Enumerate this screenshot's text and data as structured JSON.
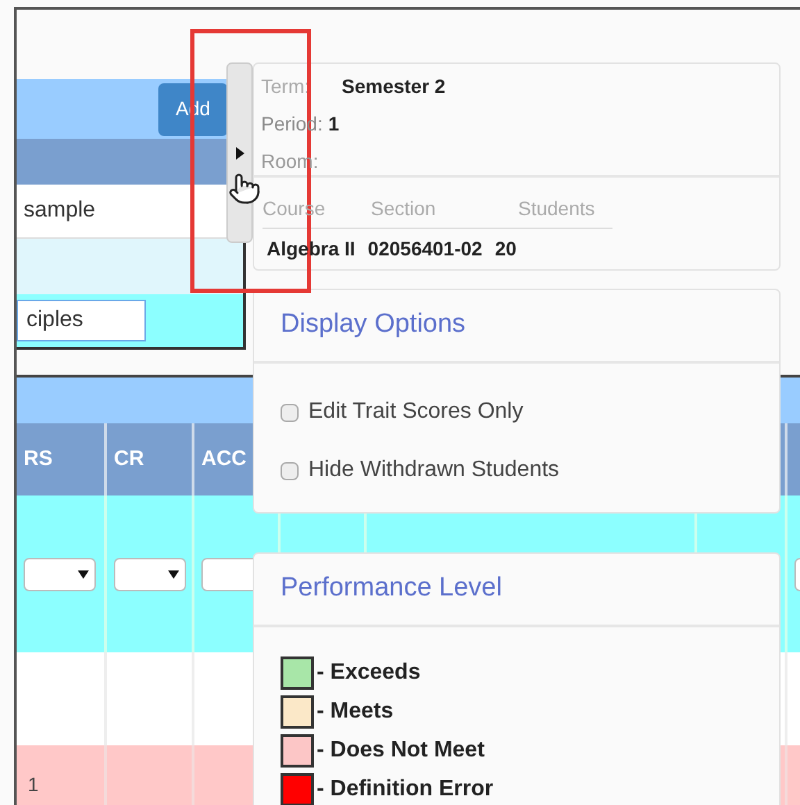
{
  "toolbar": {
    "add_button": "Add"
  },
  "list": {
    "item": "sample",
    "name_field": {
      "value": "ciples"
    }
  },
  "table": {
    "columns": [
      {
        "label": "RS"
      },
      {
        "label": "CR"
      },
      {
        "label": "ACC"
      }
    ],
    "rows": [
      {
        "cells": [
          "1"
        ]
      }
    ]
  },
  "info_panel": {
    "term": {
      "label": "Term:",
      "value": "Semester 2"
    },
    "period": {
      "label": "Period:",
      "value": "1"
    },
    "room": {
      "label": "Room:"
    },
    "course_table": {
      "columns": [
        "Course",
        "Section",
        "Students"
      ],
      "row": [
        "Algebra II",
        "02056401-02",
        "20"
      ]
    }
  },
  "display_options": {
    "title": "Display Options",
    "options": [
      {
        "label": "Edit Trait Scores Only",
        "checked": false
      },
      {
        "label": "Hide Withdrawn Students",
        "checked": false
      }
    ]
  },
  "performance_level": {
    "title": "Performance Level",
    "legend": [
      {
        "label": "- Exceeds",
        "color": "#a8e6a8"
      },
      {
        "label": "- Meets",
        "color": "#fbe8c8"
      },
      {
        "label": "- Does Not Meet",
        "color": "#fcc6c6"
      },
      {
        "label": "- Definition Error",
        "color": "#ff0000"
      }
    ]
  }
}
